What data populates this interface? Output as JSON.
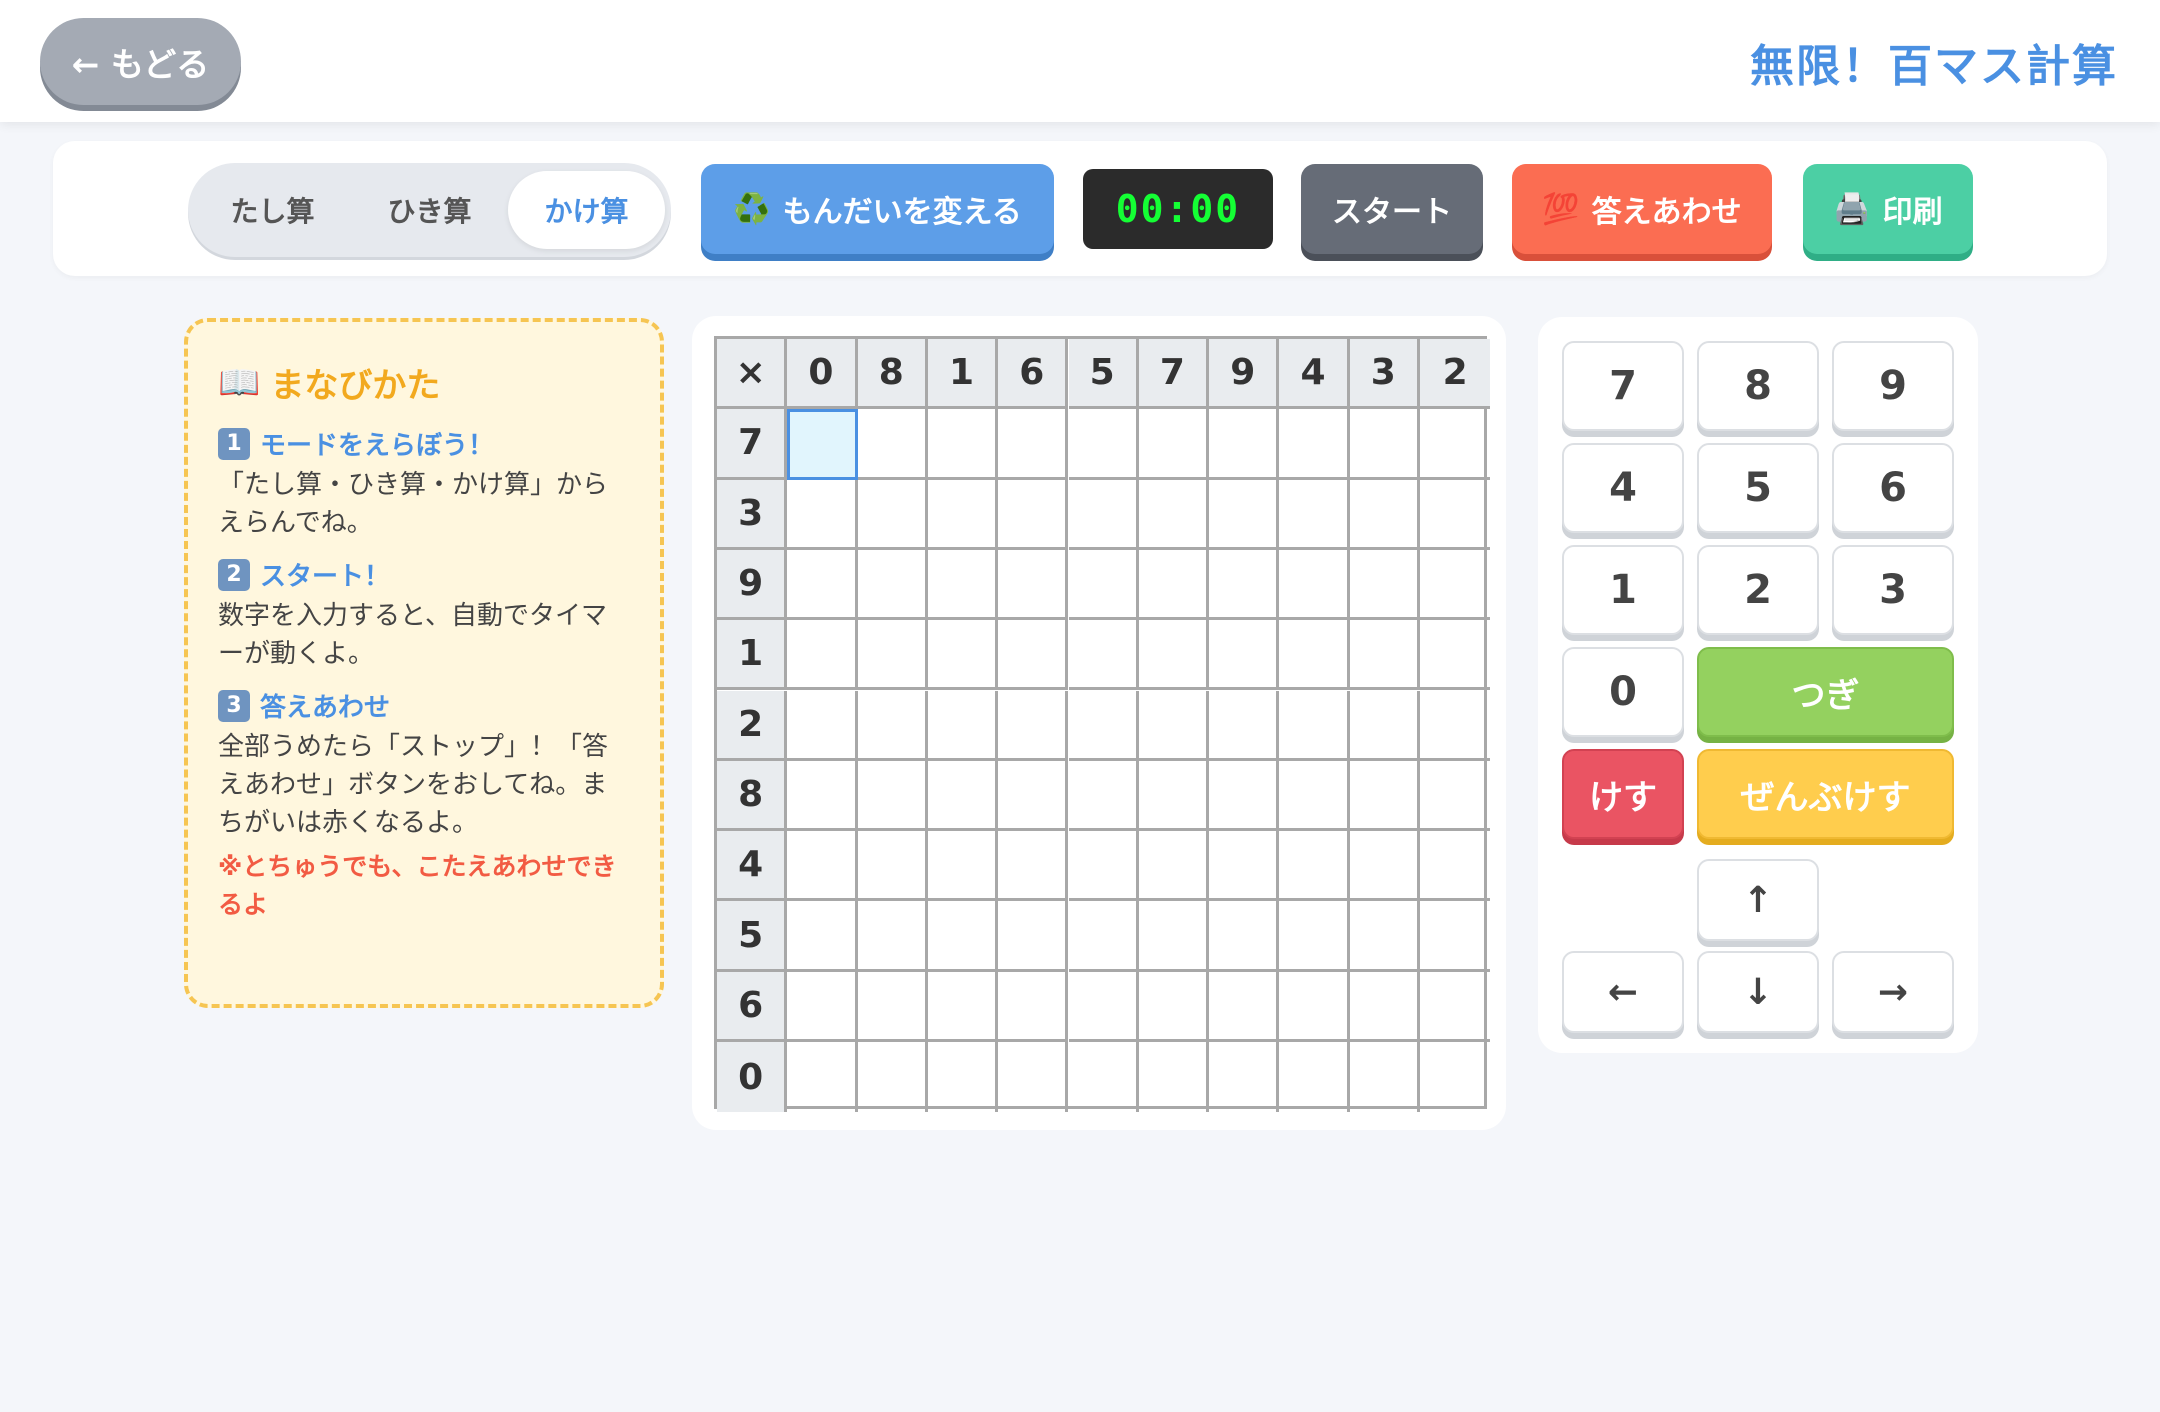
{
  "header": {
    "back_label": "← もどる",
    "title": "無限！百マス計算"
  },
  "toolbar": {
    "modes": [
      {
        "label": "たし算",
        "active": false
      },
      {
        "label": "ひき算",
        "active": false
      },
      {
        "label": "かけ算",
        "active": true
      }
    ],
    "change_icon": "♻️",
    "change_label": "もんだいを変える",
    "timer": "00:00",
    "start_label": "スタート",
    "check_icon": "💯",
    "check_label": "答えあわせ",
    "print_icon": "🖨️",
    "print_label": "印刷"
  },
  "help": {
    "icon": "📖",
    "title": "まなびかた",
    "steps": [
      {
        "num": "1",
        "title": "モードをえらぼう！",
        "body": "「たし算・ひき算・かけ算」からえらんでね。"
      },
      {
        "num": "2",
        "title": "スタート！",
        "body": "数字を入力すると、自動でタイマーが動くよ。"
      },
      {
        "num": "3",
        "title": "答えあわせ",
        "body": "全部うめたら「ストップ」！「答えあわせ」ボタンをおしてね。まちがいは赤くなるよ。"
      }
    ],
    "note": "※とちゅうでも、こたえあわせできるよ"
  },
  "grid": {
    "operator": "×",
    "columns": [
      "0",
      "8",
      "1",
      "6",
      "5",
      "7",
      "9",
      "4",
      "3",
      "2"
    ],
    "rows": [
      "7",
      "3",
      "9",
      "1",
      "2",
      "8",
      "4",
      "5",
      "6",
      "0"
    ],
    "selected_cell": "r0c0"
  },
  "keypad": {
    "digits": [
      "7",
      "8",
      "9",
      "4",
      "5",
      "6",
      "1",
      "2",
      "3",
      "0"
    ],
    "next_label": "つぎ",
    "delete_label": "けす",
    "clear_label": "ぜんぶけす",
    "arrow_up": "↑",
    "arrow_left": "←",
    "arrow_down": "↓",
    "arrow_right": "→"
  }
}
